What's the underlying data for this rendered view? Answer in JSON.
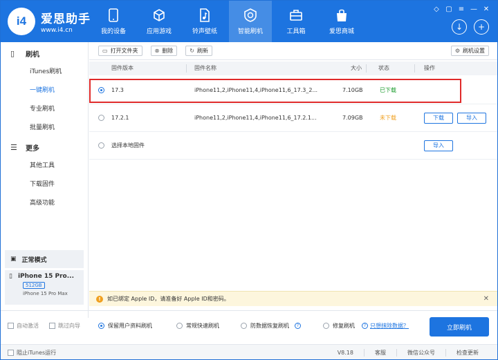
{
  "app": {
    "name": "爱思助手",
    "url": "www.i4.cn",
    "logo_letter": "i4"
  },
  "nav": [
    {
      "label": "我的设备",
      "icon": "phone-icon"
    },
    {
      "label": "应用游戏",
      "icon": "cube-icon"
    },
    {
      "label": "铃声壁纸",
      "icon": "music-file-icon"
    },
    {
      "label": "智能刷机",
      "icon": "refresh-shield-icon"
    },
    {
      "label": "工具箱",
      "icon": "toolbox-icon"
    },
    {
      "label": "爱思商城",
      "icon": "shopping-bag-icon"
    }
  ],
  "sidebar": {
    "flash_group": "刷机",
    "flash_items": [
      "iTunes刷机",
      "一键刷机",
      "专业刷机",
      "批量刷机"
    ],
    "more_group": "更多",
    "more_items": [
      "其他工具",
      "下载固件",
      "高级功能"
    ],
    "mode": "正常模式",
    "device": {
      "name": "iPhone 15 Pro...",
      "storage": "512GB",
      "model": "iPhone 15 Pro Max"
    }
  },
  "toolbar": {
    "open_folder": "打开文件夹",
    "delete": "删除",
    "refresh": "刷新",
    "settings": "刷机设置"
  },
  "table": {
    "headers": {
      "version": "固件版本",
      "name": "固件名称",
      "size": "大小",
      "status": "状态",
      "action": "操作"
    },
    "rows": [
      {
        "version": "17.3",
        "name": "iPhone11,2,iPhone11,4,iPhone11,6_17.3_2...",
        "size": "7.10GB",
        "status": "已下载",
        "status_color": "#1a9c2c",
        "download": "",
        "import": ""
      },
      {
        "version": "17.2.1",
        "name": "iPhone11,2,iPhone11,4,iPhone11,6_17.2.1...",
        "size": "7.09GB",
        "status": "未下载",
        "status_color": "#f0a020",
        "download": "下载",
        "import": "导入"
      }
    ],
    "local_row": {
      "label": "选择本地固件",
      "import": "导入"
    }
  },
  "notice": "如已绑定 Apple ID，请准备好 Apple ID和密码。",
  "options": {
    "auto_activate": "自动激活",
    "skip_guide": "跳过向导",
    "keep_data": "保留用户资料刷机",
    "quick_flash": "常规快速刷机",
    "anti_recovery": "防数据恢复刷机",
    "repair_flash": "修复刷机",
    "erase_link": "只想抹除数据？",
    "flash_now": "立即刷机"
  },
  "statusbar": {
    "block_itunes": "阻止iTunes运行",
    "version": "V8.18",
    "service": "客服",
    "wechat": "微信公众号",
    "update": "检查更新"
  },
  "colors": {
    "brand": "#1d74e0",
    "highlight": "#e02a2a"
  }
}
